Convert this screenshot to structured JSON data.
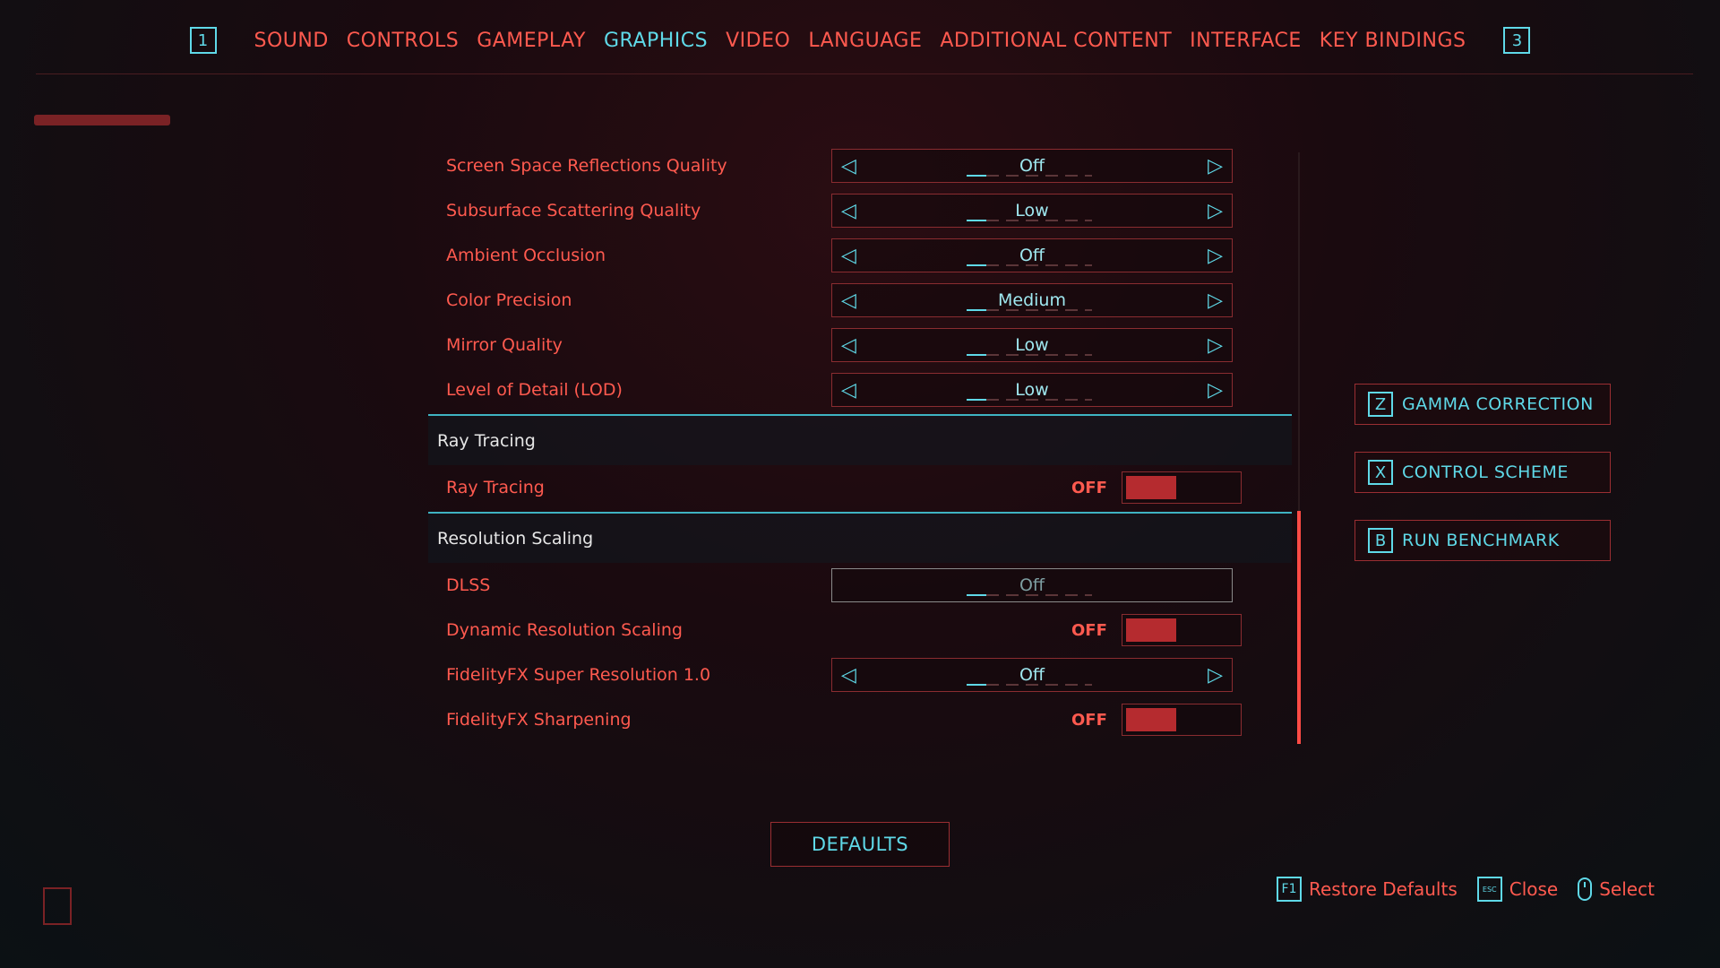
{
  "topnav": {
    "left_key": "1",
    "right_key": "3",
    "tabs": [
      {
        "label": "SOUND"
      },
      {
        "label": "CONTROLS"
      },
      {
        "label": "GAMEPLAY"
      },
      {
        "label": "GRAPHICS",
        "active": true
      },
      {
        "label": "VIDEO"
      },
      {
        "label": "LANGUAGE"
      },
      {
        "label": "ADDITIONAL CONTENT"
      },
      {
        "label": "INTERFACE"
      },
      {
        "label": "KEY BINDINGS"
      }
    ]
  },
  "settings": {
    "rows": [
      {
        "label": "Screen Space Reflections Quality",
        "value": "Off"
      },
      {
        "label": "Subsurface Scattering Quality",
        "value": "Low"
      },
      {
        "label": "Ambient Occlusion",
        "value": "Off"
      },
      {
        "label": "Color Precision",
        "value": "Medium"
      },
      {
        "label": "Mirror Quality",
        "value": "Low"
      },
      {
        "label": "Level of Detail (LOD)",
        "value": "Low"
      }
    ],
    "ray_tracing": {
      "section_title": "Ray Tracing",
      "toggle_label": "Ray Tracing",
      "toggle_state": "OFF"
    },
    "resolution_scaling": {
      "section_title": "Resolution Scaling",
      "dlss_label": "DLSS",
      "dlss_value": "Off",
      "dynamic_label": "Dynamic Resolution Scaling",
      "dynamic_state": "OFF",
      "fsr_label": "FidelityFX Super Resolution 1.0",
      "fsr_value": "Off",
      "sharpening_label": "FidelityFX Sharpening",
      "sharpening_state": "OFF"
    }
  },
  "side_buttons": [
    {
      "key": "Z",
      "label": "GAMMA CORRECTION"
    },
    {
      "key": "X",
      "label": "CONTROL SCHEME"
    },
    {
      "key": "B",
      "label": "RUN BENCHMARK"
    }
  ],
  "defaults_label": "DEFAULTS",
  "hints": {
    "restore_key": "F1",
    "restore_label": "Restore Defaults",
    "close_key": "ESC",
    "close_label": "Close",
    "select_label": "Select"
  },
  "colors": {
    "accent_red": "#ff5a4f",
    "accent_cyan": "#5fd9e8",
    "toggle_knob": "#b52b2f"
  }
}
